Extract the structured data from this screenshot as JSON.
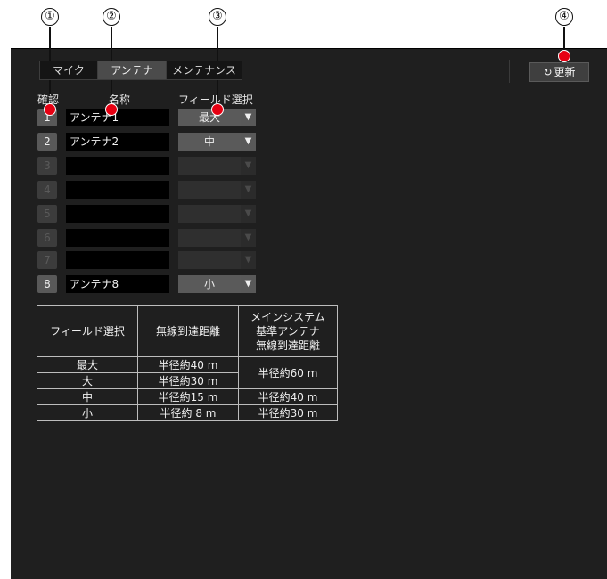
{
  "callouts": [
    "①",
    "②",
    "③",
    "④"
  ],
  "tabs": [
    {
      "label": "マイク",
      "active": false
    },
    {
      "label": "アンテナ",
      "active": true
    },
    {
      "label": "メンテナンス",
      "active": false
    }
  ],
  "refresh_label": "更新",
  "icons": {
    "refresh": "refresh-icon",
    "dropdown": "dropdown-arrow-icon"
  },
  "headers": {
    "confirm": "確認",
    "name": "名称",
    "field": "フィールド選択"
  },
  "antennas": [
    {
      "number": "1",
      "name": "アンテナ1",
      "field": "最大",
      "enabled": true
    },
    {
      "number": "2",
      "name": "アンテナ2",
      "field": "中",
      "enabled": true
    },
    {
      "number": "3",
      "name": "",
      "field": "",
      "enabled": false
    },
    {
      "number": "4",
      "name": "",
      "field": "",
      "enabled": false
    },
    {
      "number": "5",
      "name": "",
      "field": "",
      "enabled": false
    },
    {
      "number": "6",
      "name": "",
      "field": "",
      "enabled": false
    },
    {
      "number": "7",
      "name": "",
      "field": "",
      "enabled": false
    },
    {
      "number": "8",
      "name": "アンテナ8",
      "field": "小",
      "enabled": true
    }
  ],
  "range_table": {
    "headers": {
      "field": "フィールド選択",
      "distance": "無線到達距離",
      "main_line1": "メインシステム",
      "main_line2": "基準アンテナ",
      "main_line3": "無線到達距離"
    },
    "rows": [
      {
        "field": "最大",
        "distance": "半径約40 m"
      },
      {
        "field": "大",
        "distance": "半径約30 m"
      },
      {
        "field": "中",
        "distance": "半径約15 m"
      },
      {
        "field": "小",
        "distance": "半径約 8 m"
      }
    ],
    "main": [
      "半径約60 m",
      "半径約40 m",
      "半径約30 m"
    ]
  },
  "colors": {
    "panel_bg": "#1f1f1f",
    "callout_dot": "#e60012"
  }
}
